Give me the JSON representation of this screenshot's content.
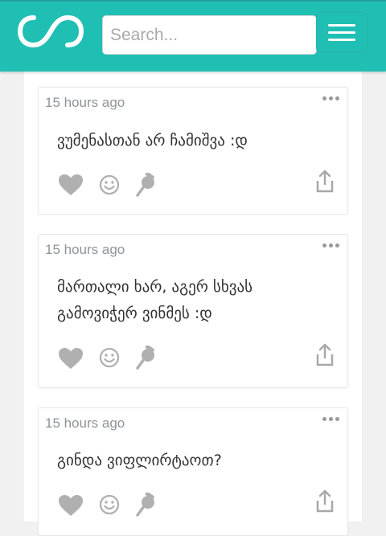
{
  "header": {
    "search_placeholder": "Search..."
  },
  "posts": [
    {
      "time": "15 hours ago",
      "text": "ვუმენასთან არ ჩამიშვა :დ"
    },
    {
      "time": "15 hours ago",
      "text": "მართალი ხარ, აგერ სხვას გამოვიჭერ ვინმეს :დ"
    },
    {
      "time": "15 hours ago",
      "text": "გინდა ვიფლირტაოთ?"
    }
  ],
  "colors": {
    "header": "#20bfb4",
    "icon_gray": "#b0b0b0",
    "time_text": "#8d9499"
  },
  "icons": [
    "infinity-logo-icon",
    "hamburger-menu-icon",
    "more-dots-icon",
    "heart-icon",
    "smiley-icon",
    "pin-icon",
    "share-icon"
  ]
}
